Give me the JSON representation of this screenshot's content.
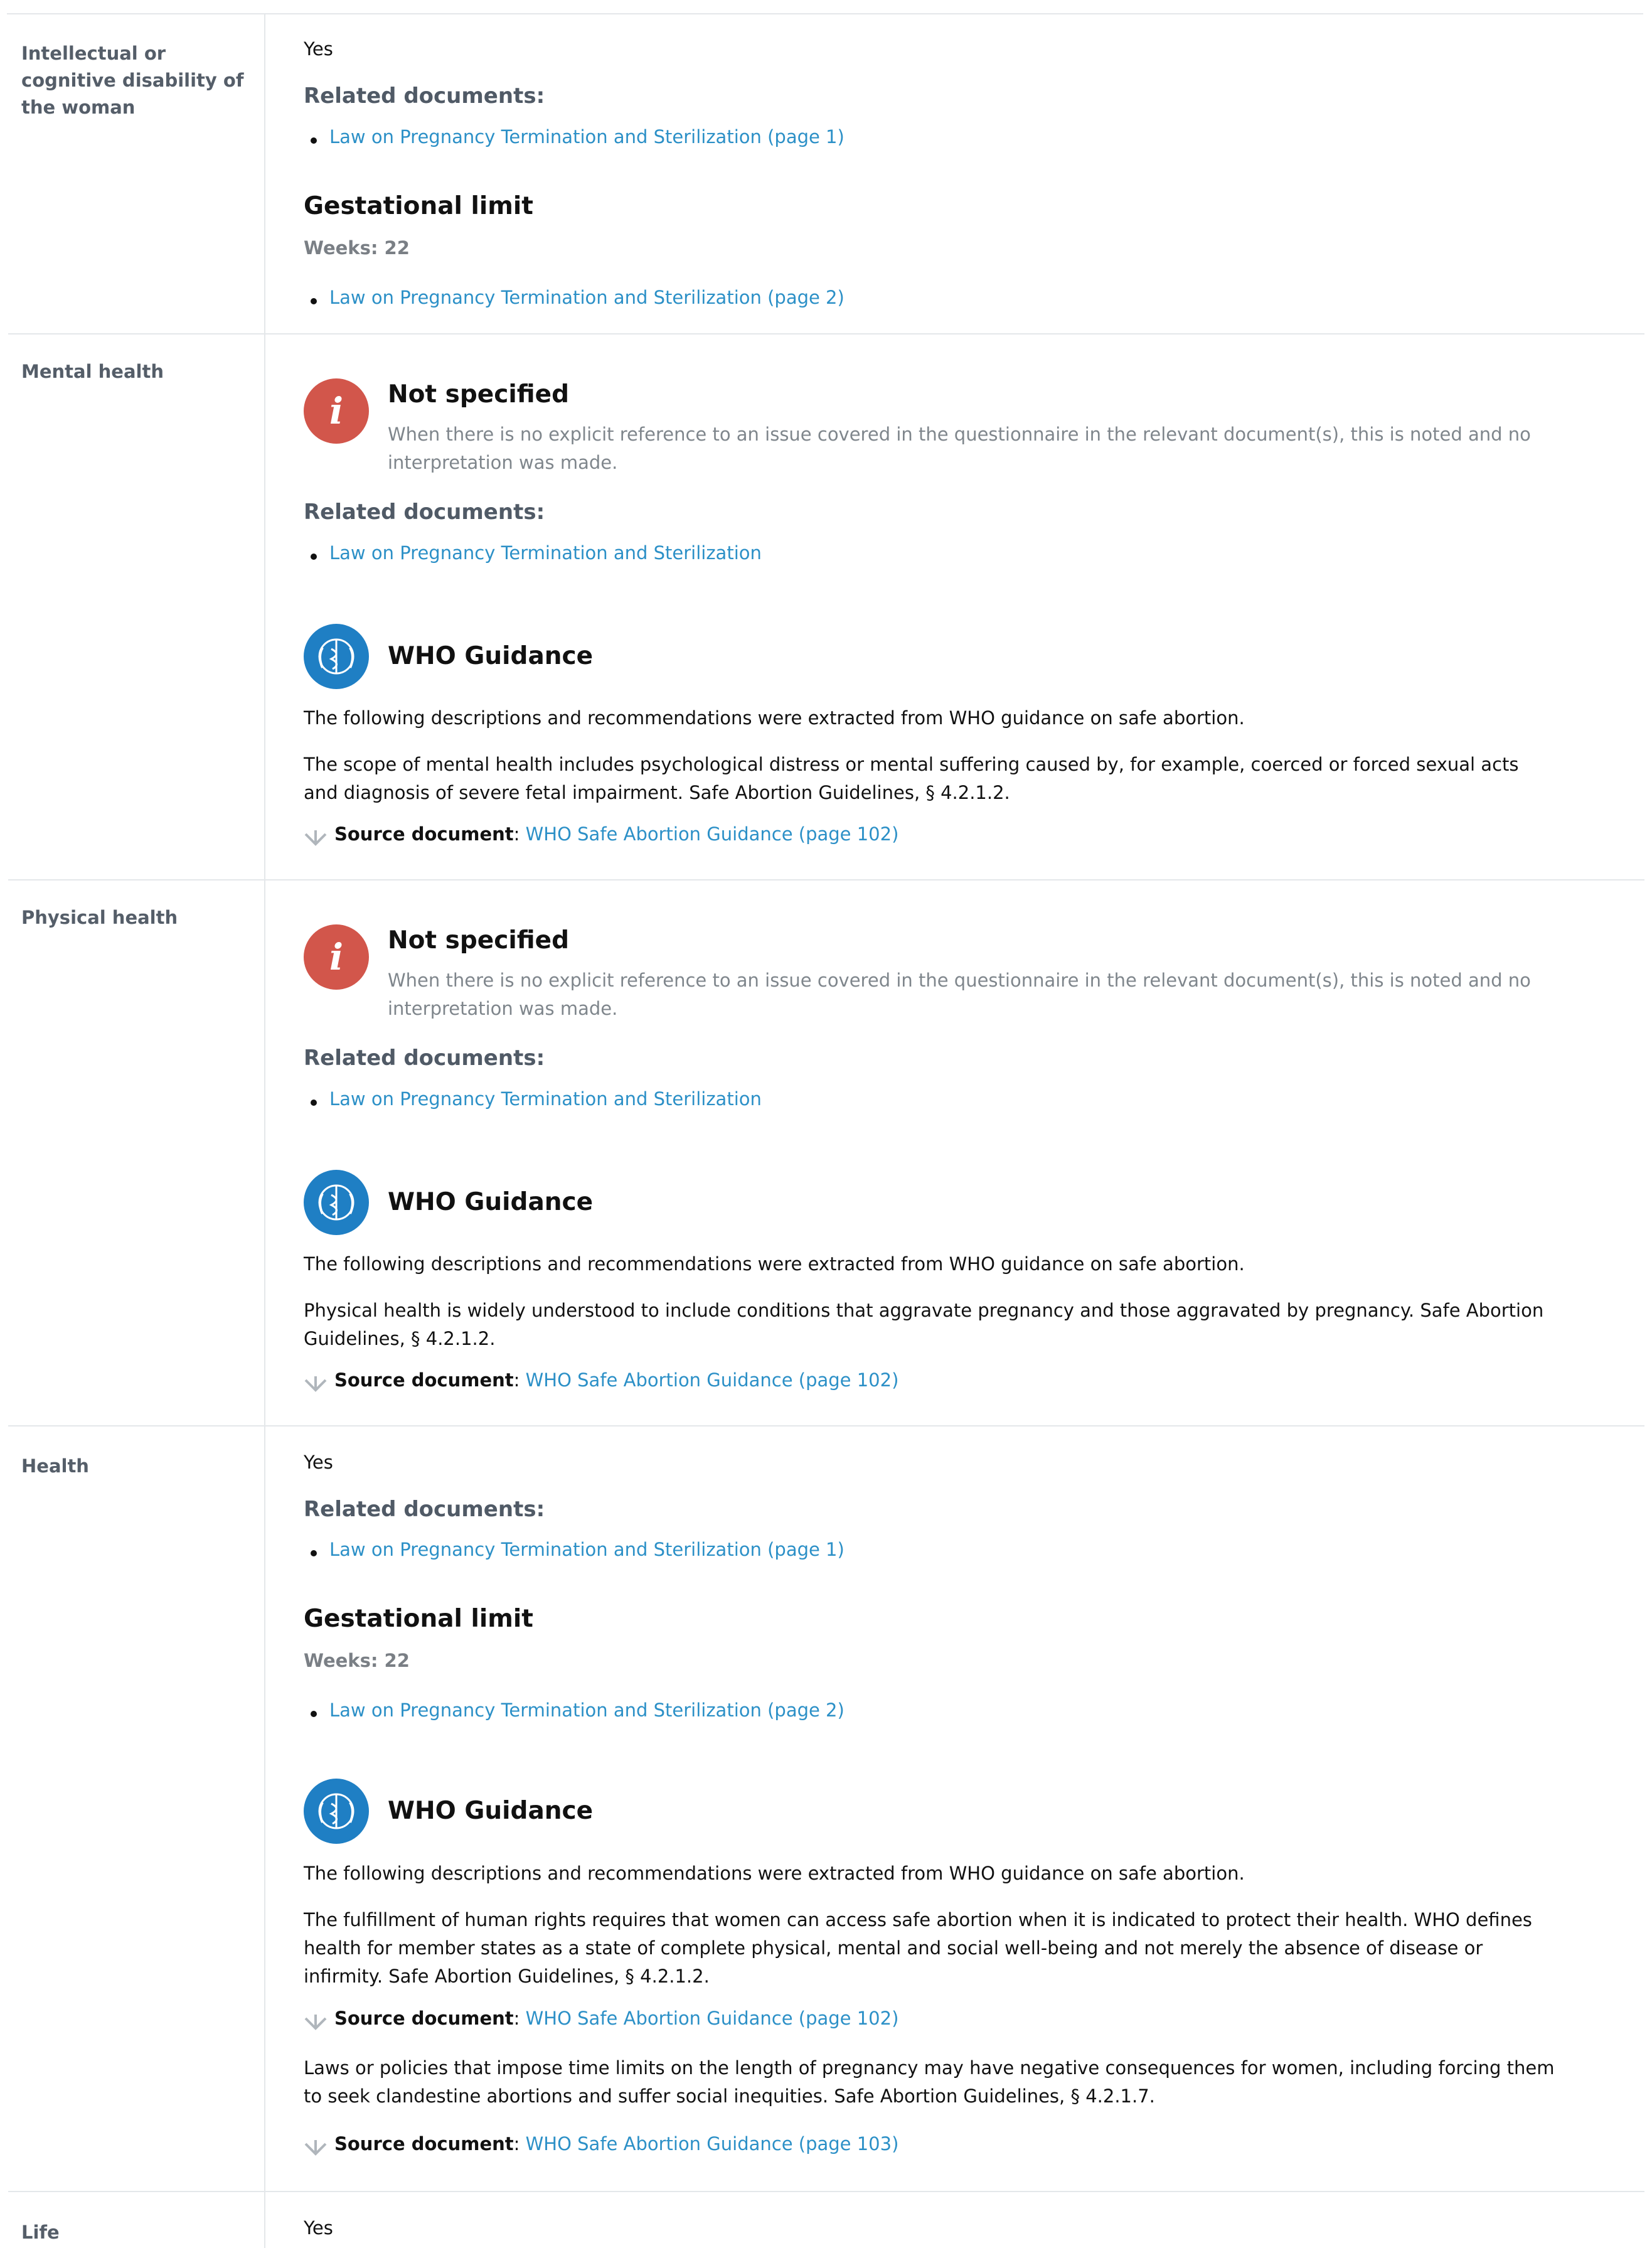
{
  "texts": {
    "yes": "Yes",
    "related_documents": "Related documents:",
    "gestational_limit": "Gestational limit",
    "weeks_22": "Weeks: 22",
    "not_specified_title": "Not specified",
    "not_specified_desc": "When there is no explicit reference to an issue covered in the questionnaire in the relevant document(s), this is noted and no interpretation was made.",
    "who_guidance_title": "WHO Guidance",
    "who_intro": "The following descriptions and recommendations were extracted from WHO guidance on safe abortion.",
    "source_document_label": "Source document",
    "source_colon": ": ",
    "link_law": "Law on Pregnancy Termination and Sterilization",
    "link_law_p1": "Law on Pregnancy Termination and Sterilization (page 1)",
    "link_law_p2": "Law on Pregnancy Termination and Sterilization (page 2)",
    "link_who_p102": "WHO Safe Abortion Guidance (page 102)",
    "link_who_p103": "WHO Safe Abortion Guidance (page 103)"
  },
  "rows": {
    "intellectual": {
      "label": "Intellectual or cognitive disability of the woman"
    },
    "mental": {
      "label": "Mental health",
      "guidance": "The scope of mental health includes psychological distress or mental suffering caused by, for example, coerced or forced sexual acts and diagnosis of severe fetal impairment. Safe Abortion Guidelines, § 4.2.1.2."
    },
    "physical": {
      "label": "Physical health",
      "guidance": "Physical health is widely understood to include conditions that aggravate pregnancy and those aggravated by pregnancy. Safe Abortion Guidelines, § 4.2.1.2."
    },
    "health": {
      "label": "Health",
      "guidance_1": "The fulfillment of human rights requires that women can access safe abortion when it is indicated to protect their health. WHO defines health for member states as a state of complete physical, mental and social well-being and not merely the absence of disease or infirmity. Safe Abortion Guidelines, § 4.2.1.2.",
      "guidance_2": "Laws or policies that impose time limits on the length of pregnancy may have negative consequences for women, including forcing them to seek clandestine abortions and suffer social inequities. Safe Abortion Guidelines, § 4.2.1.7."
    },
    "life": {
      "label": "Life"
    }
  },
  "colors": {
    "link": "#2c90c7",
    "not_specified_icon": "#d2564b",
    "who_icon": "#1f7fc4",
    "label": "#555e69",
    "border": "#e4e7ea"
  },
  "icons": {
    "not_specified": "info-icon",
    "who": "who-emblem-icon",
    "source": "arrow-down-icon"
  }
}
